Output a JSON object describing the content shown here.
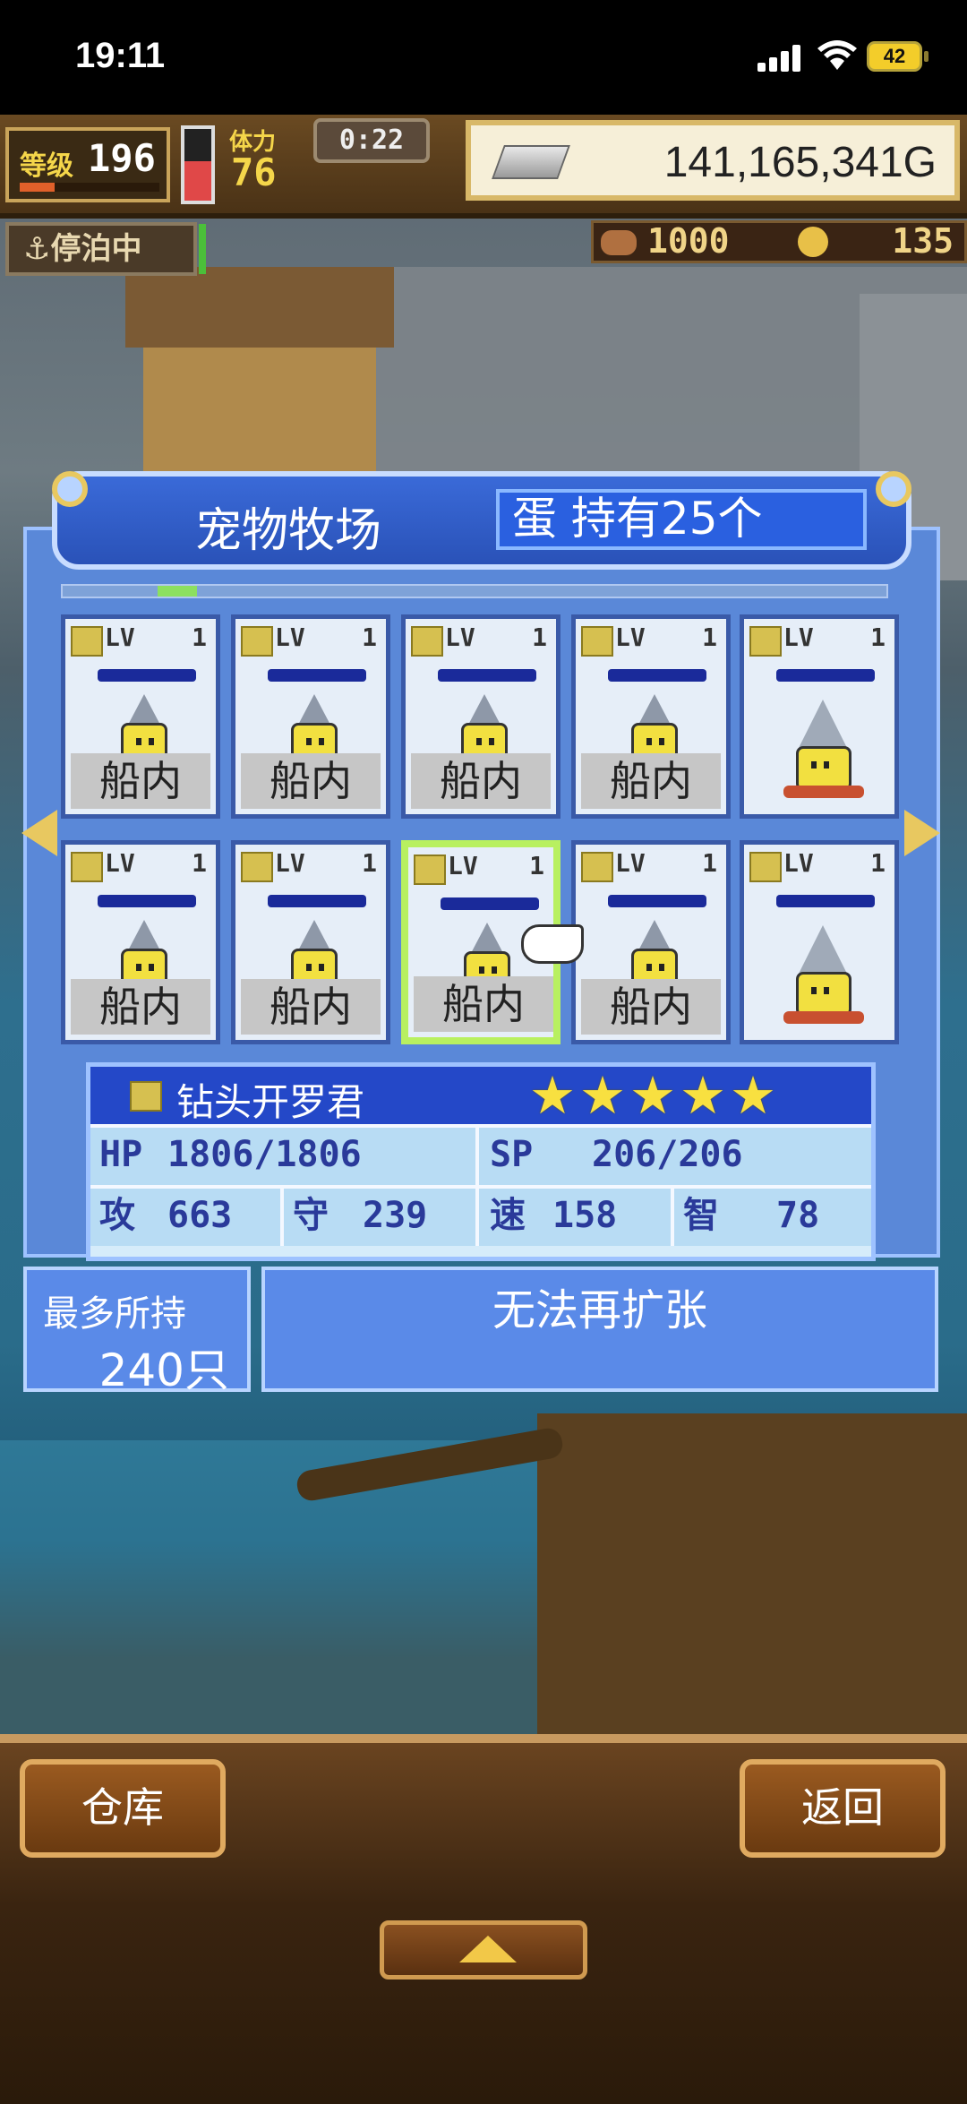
{
  "status": {
    "time": "19:11",
    "battery": "42"
  },
  "hud": {
    "level_tag": "等级",
    "level": "196",
    "exp_fraction": 0.25,
    "stamina_tag": "体力",
    "stamina": "76",
    "stamina_fraction": 0.55,
    "timer": "0:22",
    "gold": "141,165,341G",
    "dock_status": "⚓停泊中",
    "resource1": "1000",
    "resource2": "135"
  },
  "ranch": {
    "title": "宠物牧场",
    "eggs": "蛋 持有25个",
    "scroll_fraction": 0.05,
    "cards": [
      {
        "lv_label": "LV",
        "lv": "1",
        "location": "船内",
        "type": "small"
      },
      {
        "lv_label": "LV",
        "lv": "1",
        "location": "船内",
        "type": "small"
      },
      {
        "lv_label": "LV",
        "lv": "1",
        "location": "船内",
        "type": "small"
      },
      {
        "lv_label": "LV",
        "lv": "1",
        "location": "船内",
        "type": "small"
      },
      {
        "lv_label": "LV",
        "lv": "1",
        "location": "",
        "type": "big"
      },
      {
        "lv_label": "LV",
        "lv": "1",
        "location": "船内",
        "type": "small"
      },
      {
        "lv_label": "LV",
        "lv": "1",
        "location": "船内",
        "type": "small"
      },
      {
        "lv_label": "LV",
        "lv": "1",
        "location": "船内",
        "type": "small",
        "selected": true
      },
      {
        "lv_label": "LV",
        "lv": "1",
        "location": "船内",
        "type": "small"
      },
      {
        "lv_label": "LV",
        "lv": "1",
        "location": "",
        "type": "big"
      }
    ]
  },
  "selected_pet": {
    "name": "钻头开罗君",
    "stars": 5,
    "hp_label": "HP",
    "hp": "1806/1806",
    "sp_label": "SP",
    "sp": "206/206",
    "atk_label": "攻",
    "atk": "663",
    "def_label": "守",
    "def": "239",
    "spd_label": "速",
    "spd": "158",
    "int_label": "智",
    "int": "78"
  },
  "capacity": {
    "label": "最多所持",
    "value": "240只",
    "expand_text": "无法再扩张"
  },
  "buttons": {
    "warehouse": "仓库",
    "back": "返回"
  },
  "colors": {
    "accent": "#2448c8",
    "star": "#f8e040",
    "selection": "#b8f060",
    "wood": "#9a5a20"
  }
}
